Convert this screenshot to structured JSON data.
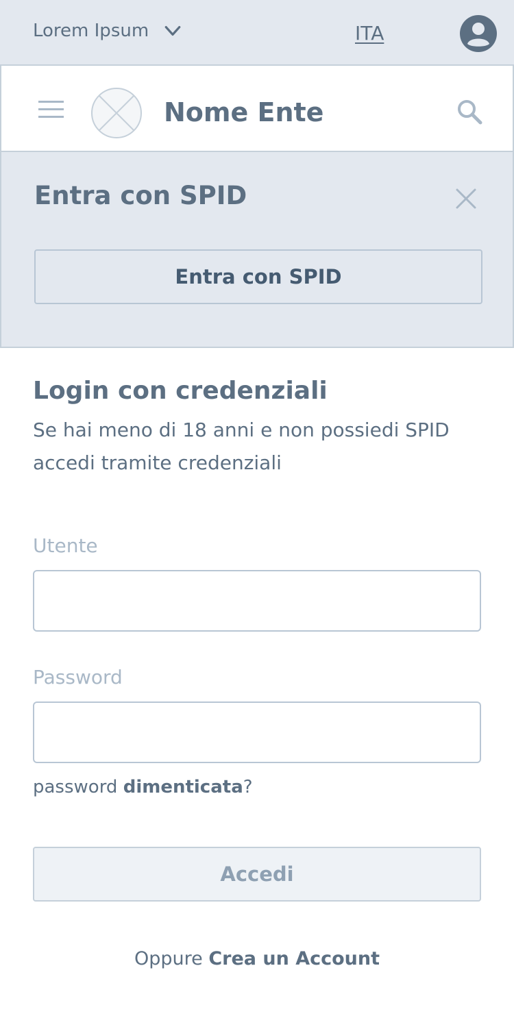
{
  "topbar": {
    "org_label": "Lorem Ipsum",
    "language": "ITA"
  },
  "header": {
    "title": "Nome Ente"
  },
  "spid": {
    "heading": "Entra con SPID",
    "button_label": "Entra con SPID"
  },
  "login": {
    "title": "Login con credenziali",
    "description": "Se hai meno di 18 anni e non possiedi SPID accedi tramite credenziali",
    "user_label": "Utente",
    "user_value": "",
    "password_label": "Password",
    "password_value": "",
    "forgot_prefix": "password",
    "forgot_link": "dimenticata",
    "forgot_suffix": "?",
    "submit_label": "Accedi",
    "create_prefix": "Oppure",
    "create_link": "Crea un Account"
  },
  "colors": {
    "bar_background": "#e3e8ef",
    "text_primary": "#5c6f82",
    "border": "#c5d0da",
    "muted": "#a9b8c7"
  },
  "icons": [
    "chevron-down-icon",
    "user-avatar-icon",
    "hamburger-menu-icon",
    "logo-placeholder-icon",
    "search-icon",
    "close-icon"
  ]
}
